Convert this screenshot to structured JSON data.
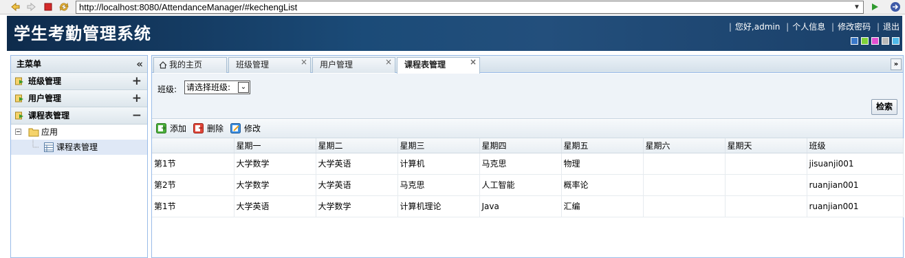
{
  "browser": {
    "url": "http://localhost:8080/AttendanceManager/#kechengList"
  },
  "header": {
    "title": "学生考勤管理系统",
    "greeting": "您好,admin",
    "profile": "个人信息",
    "change_password": "修改密码",
    "logout": "退出",
    "theme_swatches": [
      "#3a78c8",
      "#7fd03a",
      "#e04fd0",
      "#b8b8b8",
      "#4fb8e8"
    ]
  },
  "sidebar": {
    "title": "主菜单",
    "sections": [
      {
        "label": "班级管理",
        "toggle": "+"
      },
      {
        "label": "用户管理",
        "toggle": "+"
      },
      {
        "label": "课程表管理",
        "toggle": "−"
      }
    ],
    "tree": {
      "folder_label": "应用",
      "item_label": "课程表管理"
    }
  },
  "tabs": [
    {
      "label": "我的主页",
      "closable": false
    },
    {
      "label": "班级管理",
      "closable": true
    },
    {
      "label": "用户管理",
      "closable": true
    },
    {
      "label": "课程表管理",
      "closable": true,
      "active": true
    }
  ],
  "filter": {
    "class_label": "班级:",
    "class_select_value": "请选择班级:",
    "search_button": "检索"
  },
  "toolbar": {
    "add": "添加",
    "delete": "删除",
    "edit": "修改"
  },
  "grid": {
    "columns": [
      "",
      "星期一",
      "星期二",
      "星期三",
      "星期四",
      "星期五",
      "星期六",
      "星期天",
      "班级"
    ],
    "rows": [
      [
        "第1节",
        "大学数学",
        "大学英语",
        "计算机",
        "马克思",
        "物理",
        "",
        "",
        "jisuanji001"
      ],
      [
        "第2节",
        "大学数学",
        "大学英语",
        "马克思",
        "人工智能",
        "概率论",
        "",
        "",
        "ruanjian001"
      ],
      [
        "第1节",
        "大学英语",
        "大学数学",
        "计算机理论",
        "Java",
        "汇编",
        "",
        "",
        "ruanjian001"
      ]
    ]
  }
}
